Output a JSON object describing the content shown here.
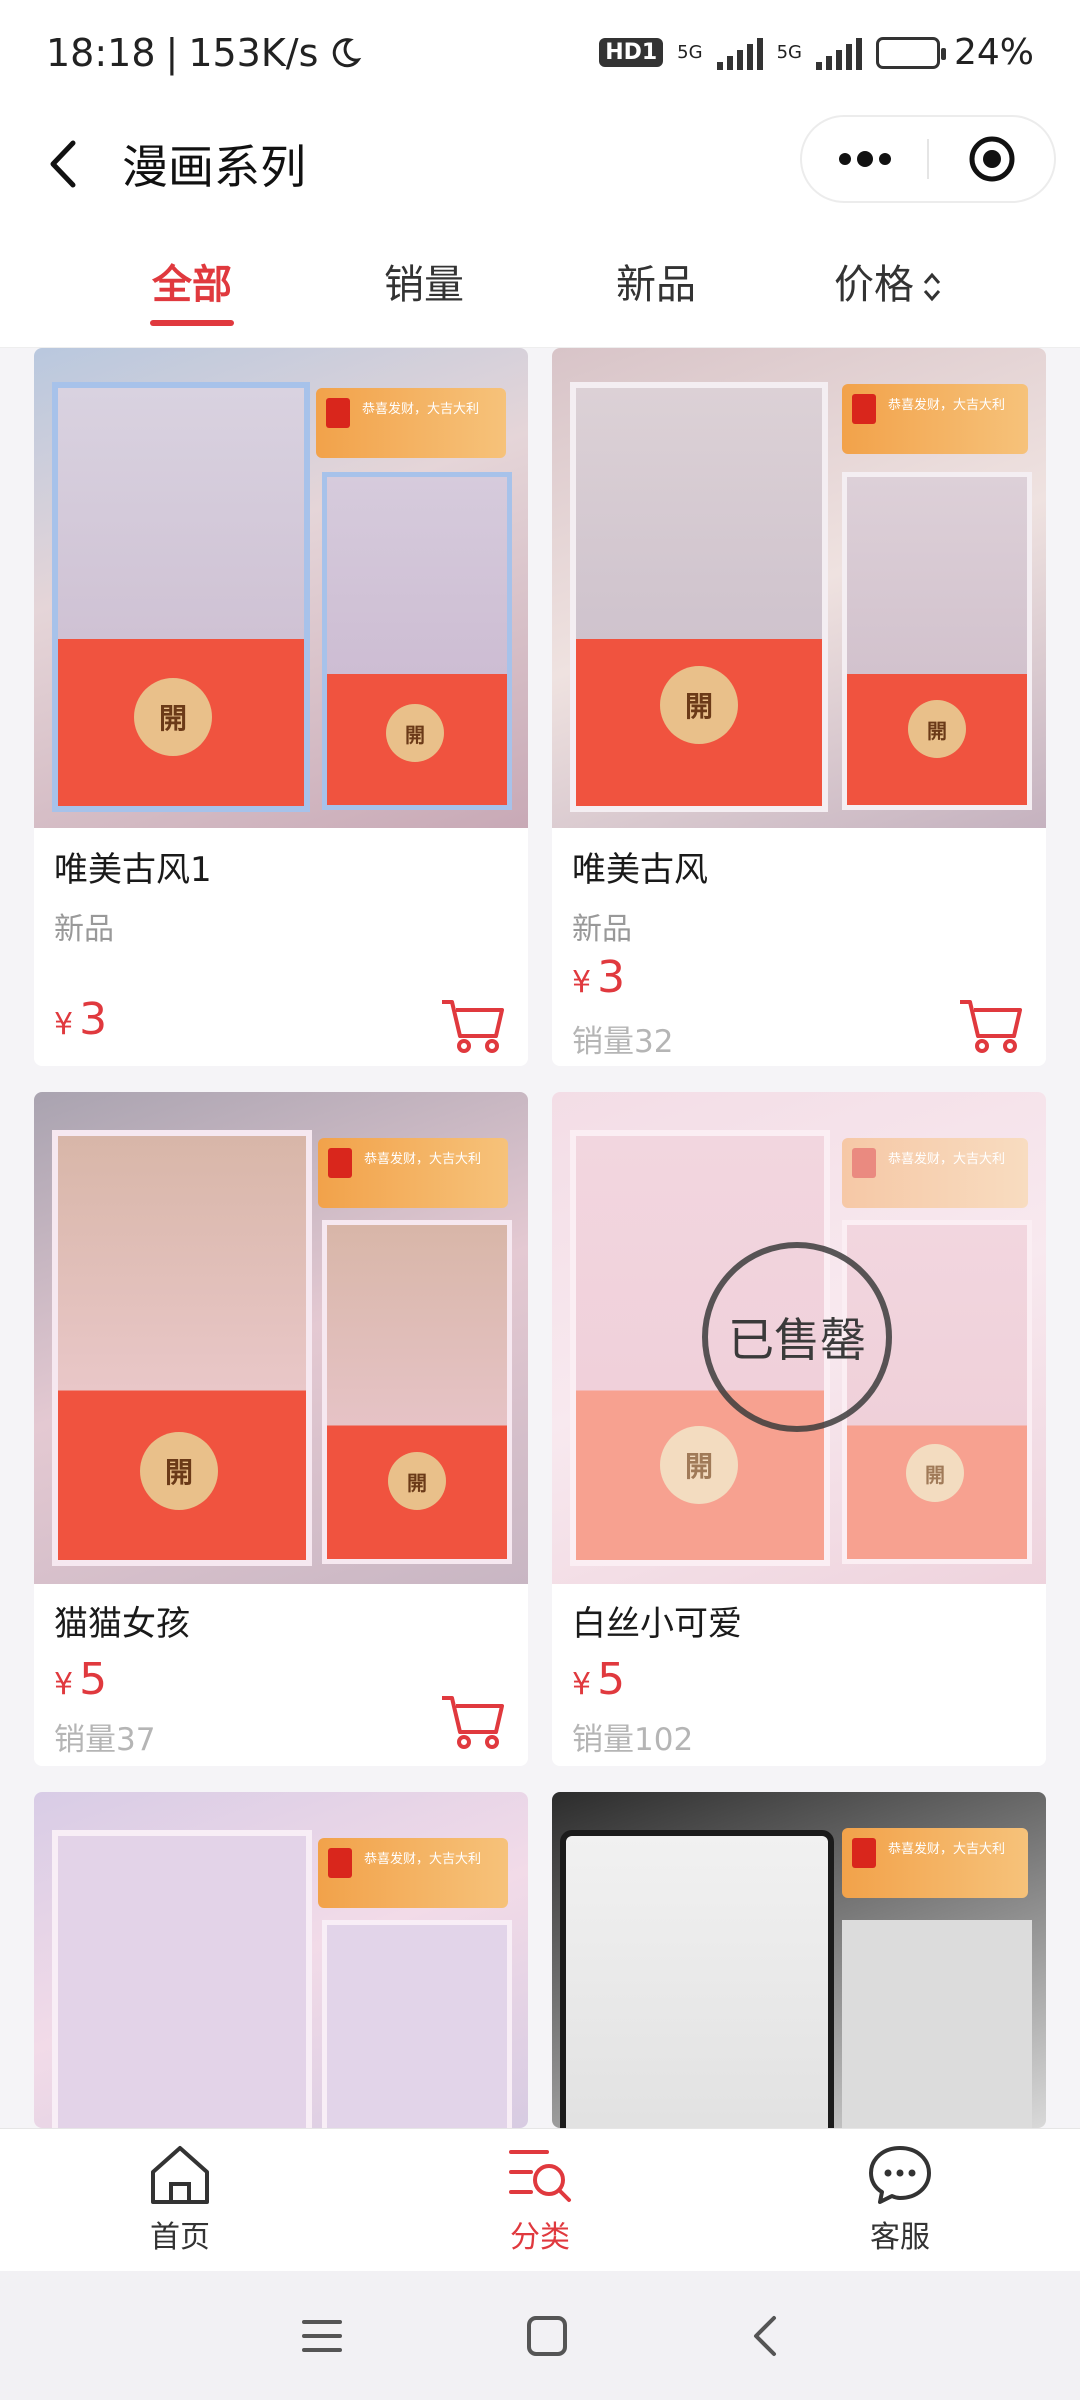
{
  "status_bar": {
    "time": "18:18",
    "speed": "153K/s",
    "hd": "HD1",
    "net1": "5G",
    "net2": "5G",
    "battery_percent": "24%",
    "battery_level": 0.24
  },
  "nav": {
    "title": "漫画系列"
  },
  "tabs": [
    {
      "label": "全部",
      "active": true
    },
    {
      "label": "销量",
      "active": false
    },
    {
      "label": "新品",
      "active": false
    },
    {
      "label": "价格",
      "active": false
    }
  ],
  "products": [
    {
      "name": "唯美古风1",
      "tag": "新品",
      "currency": "¥",
      "price": "3",
      "sales": "",
      "sold_out": false
    },
    {
      "name": "唯美古风",
      "tag": "新品",
      "currency": "¥",
      "price": "3",
      "sales": "销量32",
      "sold_out": false
    },
    {
      "name": "猫猫女孩",
      "tag": "",
      "currency": "¥",
      "price": "5",
      "sales": "销量37",
      "sold_out": false
    },
    {
      "name": "白丝小可爱",
      "tag": "",
      "currency": "¥",
      "price": "5",
      "sales": "销量102",
      "sold_out": true,
      "sold_out_label": "已售罄"
    }
  ],
  "envelope_text": {
    "open_char": "開",
    "ticket_text": "恭喜发财，大吉大利"
  },
  "tabbar": [
    {
      "label": "首页",
      "icon": "home-icon",
      "active": false
    },
    {
      "label": "分类",
      "icon": "category-icon",
      "active": true
    },
    {
      "label": "客服",
      "icon": "chat-icon",
      "active": false
    }
  ],
  "colors": {
    "accent": "#e0393e",
    "envelope_red": "#f0533f",
    "coin": "#e9c08a"
  }
}
